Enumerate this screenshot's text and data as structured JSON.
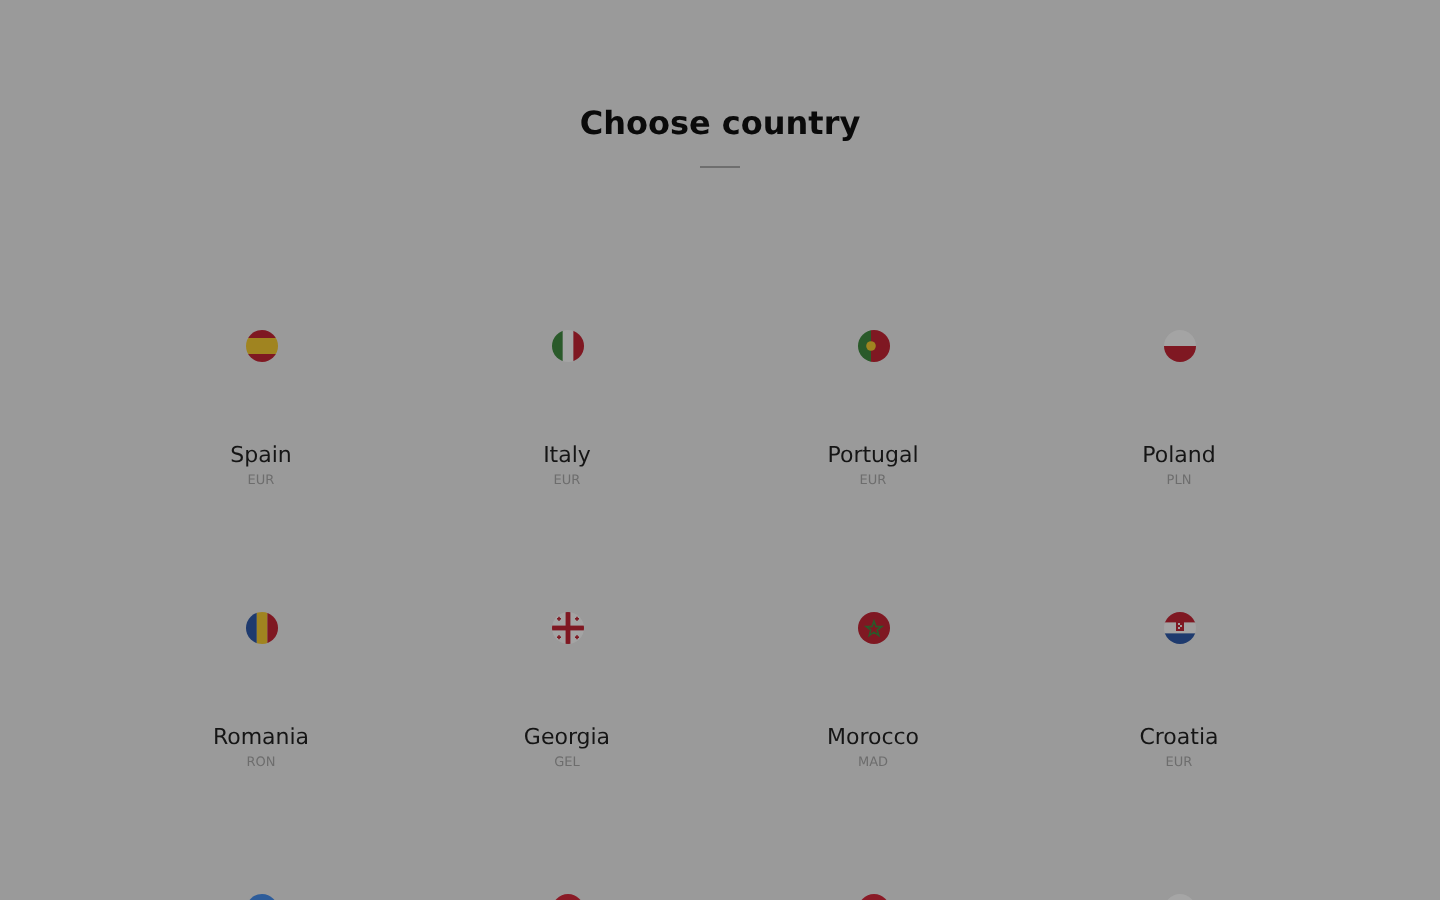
{
  "title": "Choose country",
  "countries": [
    {
      "kind": "spain",
      "name": "Spain",
      "currency": "EUR"
    },
    {
      "kind": "italy",
      "name": "Italy",
      "currency": "EUR"
    },
    {
      "kind": "portugal",
      "name": "Portugal",
      "currency": "EUR"
    },
    {
      "kind": "poland",
      "name": "Poland",
      "currency": "PLN"
    },
    {
      "kind": "romania",
      "name": "Romania",
      "currency": "RON"
    },
    {
      "kind": "georgia",
      "name": "Georgia",
      "currency": "GEL"
    },
    {
      "kind": "morocco",
      "name": "Morocco",
      "currency": "MAD"
    },
    {
      "kind": "croatia",
      "name": "Croatia",
      "currency": "EUR"
    },
    {
      "kind": "plain",
      "color": "#2d5c9a"
    },
    {
      "kind": "plain",
      "color": "#8a1a26"
    },
    {
      "kind": "plain",
      "color": "#8a1a26"
    },
    {
      "kind": "plain",
      "color": "#a6a6a6"
    }
  ]
}
